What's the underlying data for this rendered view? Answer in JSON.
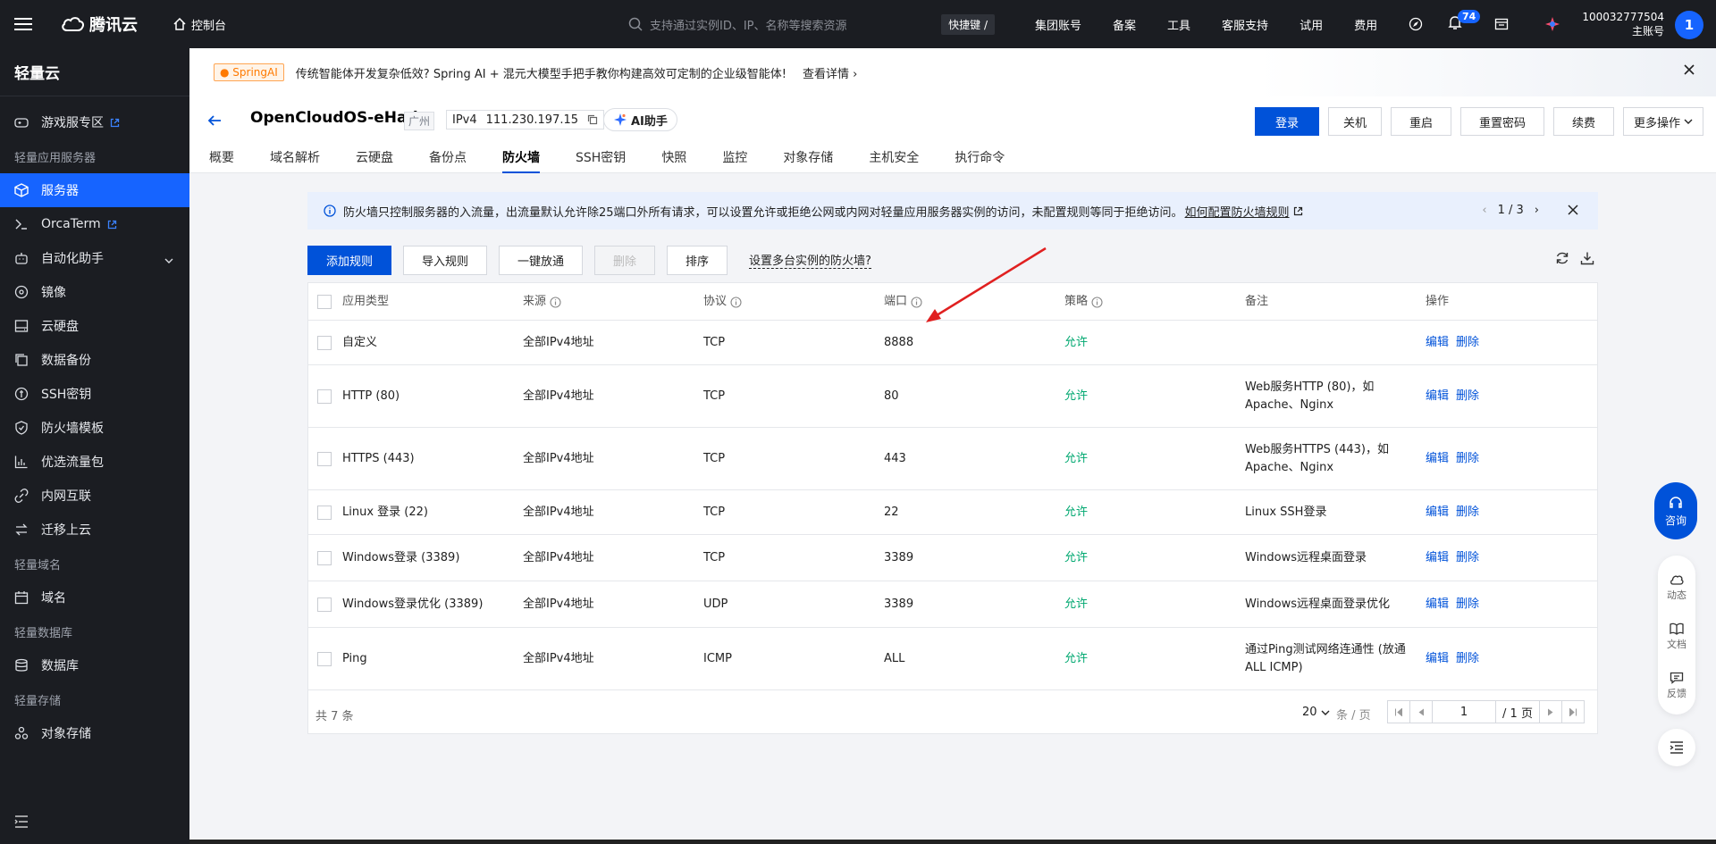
{
  "topbar": {
    "brand": "腾讯云",
    "console": "控制台",
    "search_placeholder": "支持通过实例ID、IP、名称等搜索资源",
    "shortcut": "快捷键 /",
    "nav": [
      "集团账号",
      "备案",
      "工具",
      "客服支持",
      "试用",
      "费用"
    ],
    "notification_count": "74",
    "account_id": "100032777504",
    "account_type": "主账号",
    "avatar": "1"
  },
  "sidebar": {
    "title": "轻量云",
    "items": [
      {
        "type": "item",
        "label": "游戏服专区",
        "icon": "gamepad-icon",
        "external": true
      },
      {
        "type": "group",
        "label": "轻量应用服务器"
      },
      {
        "type": "item",
        "label": "服务器",
        "icon": "cube-icon",
        "active": true
      },
      {
        "type": "item",
        "label": "OrcaTerm",
        "icon": "terminal-icon",
        "external": true
      },
      {
        "type": "item",
        "label": "自动化助手",
        "icon": "robot-icon",
        "expandable": true
      },
      {
        "type": "item",
        "label": "镜像",
        "icon": "disc-icon"
      },
      {
        "type": "item",
        "label": "云硬盘",
        "icon": "disk-icon"
      },
      {
        "type": "item",
        "label": "数据备份",
        "icon": "backup-icon"
      },
      {
        "type": "item",
        "label": "SSH密钥",
        "icon": "key-icon"
      },
      {
        "type": "item",
        "label": "防火墙模板",
        "icon": "shield-icon"
      },
      {
        "type": "item",
        "label": "优选流量包",
        "icon": "chart-icon"
      },
      {
        "type": "item",
        "label": "内网互联",
        "icon": "link-icon"
      },
      {
        "type": "item",
        "label": "迁移上云",
        "icon": "migrate-icon"
      },
      {
        "type": "group",
        "label": "轻量域名"
      },
      {
        "type": "item",
        "label": "域名",
        "icon": "calendar-icon"
      },
      {
        "type": "group",
        "label": "轻量数据库"
      },
      {
        "type": "item",
        "label": "数据库",
        "icon": "database-icon"
      },
      {
        "type": "group",
        "label": "轻量存储"
      },
      {
        "type": "item",
        "label": "对象存储",
        "icon": "storage-icon"
      }
    ]
  },
  "banner": {
    "tag": "SpringAI",
    "text": "传统智能体开发复杂低效? Spring AI + 混元大模型手把手教你构建高效可定制的企业级智能体!",
    "link": "查看详情"
  },
  "header": {
    "server_name": "OpenCloudOS-eHad",
    "region": "广州",
    "ip_version": "IPv4",
    "ip": "111.230.197.15",
    "ai_button": "AI助手",
    "actions": [
      "登录",
      "关机",
      "重启",
      "重置密码",
      "续费",
      "更多操作"
    ],
    "tabs": [
      "概要",
      "域名解析",
      "云硬盘",
      "备份点",
      "防火墙",
      "SSH密钥",
      "快照",
      "监控",
      "对象存储",
      "主机安全",
      "执行命令"
    ],
    "active_tab": 4
  },
  "notice": {
    "text": "防火墙只控制服务器的入流量，出流量默认允许除25端口外所有请求，可以设置允许或拒绝公网或内网对轻量应用服务器实例的访问，未配置规则等同于拒绝访问。",
    "link": "如何配置防火墙规则",
    "page": "1 / 3"
  },
  "toolbar": {
    "add": "添加规则",
    "import": "导入规则",
    "allow_all": "一键放通",
    "delete": "删除",
    "sort": "排序",
    "multi": "设置多台实例的防火墙?"
  },
  "table": {
    "columns": [
      "应用类型",
      "来源",
      "协议",
      "端口",
      "策略",
      "备注",
      "操作"
    ],
    "rows": [
      {
        "app": "自定义",
        "source": "全部IPv4地址",
        "protocol": "TCP",
        "port": "8888",
        "policy": "允许",
        "note": ""
      },
      {
        "app": "HTTP (80)",
        "source": "全部IPv4地址",
        "protocol": "TCP",
        "port": "80",
        "policy": "允许",
        "note": "Web服务HTTP (80)，如 Apache、Nginx"
      },
      {
        "app": "HTTPS (443)",
        "source": "全部IPv4地址",
        "protocol": "TCP",
        "port": "443",
        "policy": "允许",
        "note": "Web服务HTTPS (443)，如 Apache、Nginx"
      },
      {
        "app": "Linux 登录 (22)",
        "source": "全部IPv4地址",
        "protocol": "TCP",
        "port": "22",
        "policy": "允许",
        "note": "Linux SSH登录"
      },
      {
        "app": "Windows登录 (3389)",
        "source": "全部IPv4地址",
        "protocol": "TCP",
        "port": "3389",
        "policy": "允许",
        "note": "Windows远程桌面登录"
      },
      {
        "app": "Windows登录优化 (3389)",
        "source": "全部IPv4地址",
        "protocol": "UDP",
        "port": "3389",
        "policy": "允许",
        "note": "Windows远程桌面登录优化"
      },
      {
        "app": "Ping",
        "source": "全部IPv4地址",
        "protocol": "ICMP",
        "port": "ALL",
        "policy": "允许",
        "note": "通过Ping测试网络连通性 (放通 ALL ICMP)"
      }
    ],
    "edit": "编辑",
    "remove": "删除",
    "total": "共 7 条",
    "page_size": "20",
    "page_size_unit": "条 / 页",
    "page_input": "1",
    "page_total": "/ 1 页"
  },
  "float": {
    "consult": "咨询",
    "items": [
      "动态",
      "文档",
      "反馈"
    ]
  }
}
